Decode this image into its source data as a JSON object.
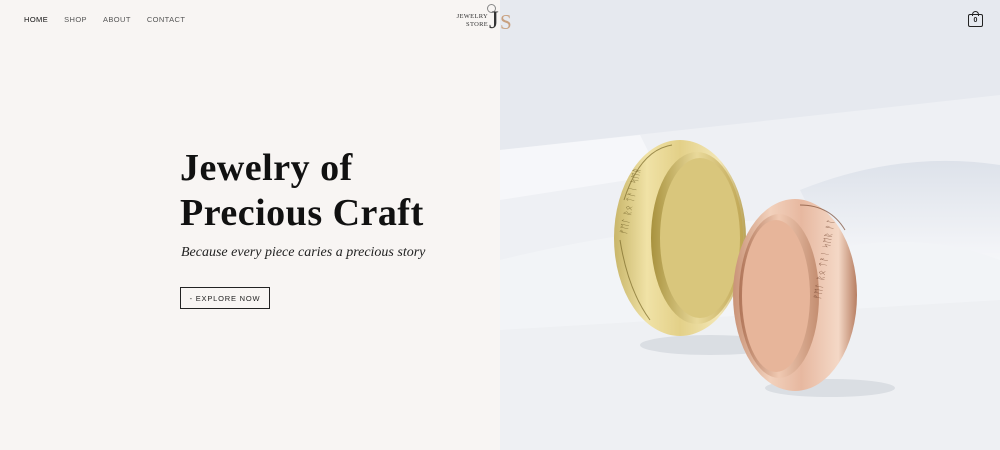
{
  "nav": {
    "items": [
      {
        "label": "HOME",
        "active": true
      },
      {
        "label": "SHOP",
        "active": false
      },
      {
        "label": "ABOUT",
        "active": false
      },
      {
        "label": "CONTACT",
        "active": false
      }
    ]
  },
  "logo": {
    "line1": "JEWELRY",
    "line2": "STORE",
    "monogram_j": "J",
    "monogram_s": "S"
  },
  "cart": {
    "count": "0",
    "icon": "shopping-bag-icon"
  },
  "hero": {
    "title_line1": "Jewelry of",
    "title_line2": "Precious Craft",
    "subtitle": "Because every piece caries a precious story",
    "cta_label": "- EXPLORE NOW"
  },
  "image": {
    "alt": "gold-and-rose-gold-engraved-rings"
  },
  "colors": {
    "background": "#f8f5f3",
    "text": "#111111",
    "accent_rose_gold": "#c8a07f",
    "gold": "#e8d894"
  }
}
